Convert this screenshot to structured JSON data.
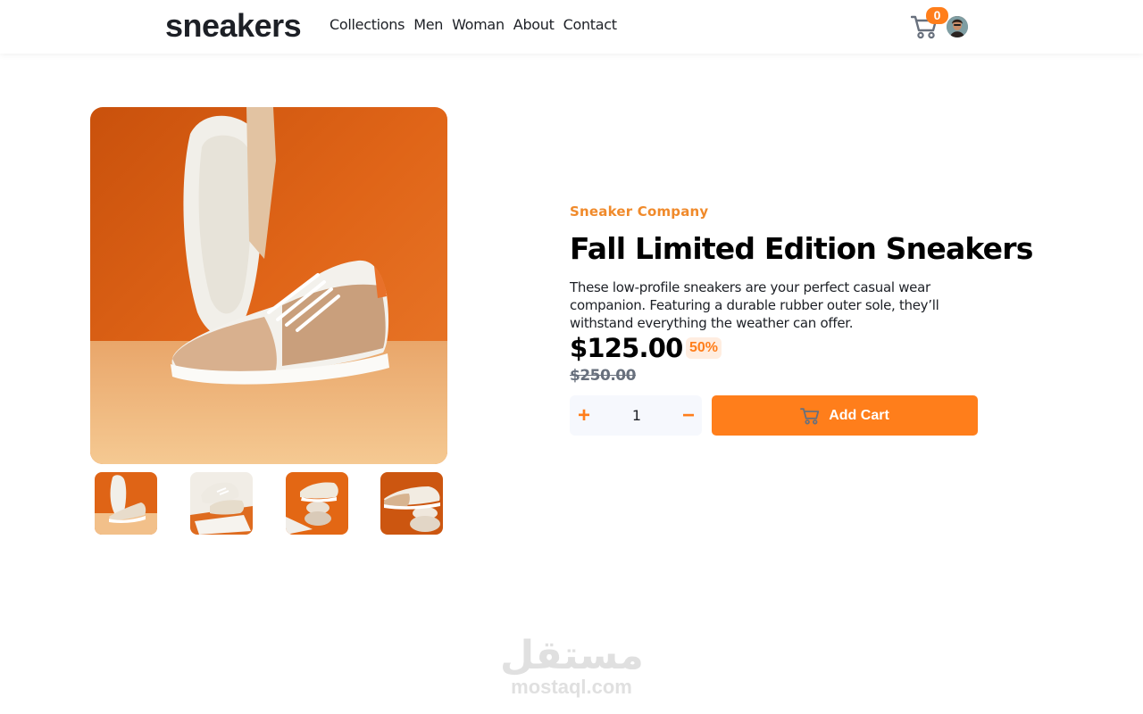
{
  "header": {
    "logo": "sneakers",
    "nav": [
      "Collections",
      "Men",
      "Woman",
      "About",
      "Contact"
    ],
    "cart_count": "0",
    "cart_icon": "cart-icon",
    "avatar": "user-avatar"
  },
  "gallery": {
    "main_image": "sneaker-sole-view",
    "thumbnails": [
      "sneaker-sole-view",
      "sneaker-on-fabric",
      "sneaker-on-stones",
      "sneaker-balanced-stones"
    ],
    "colors": {
      "orange_background": "#e46a14",
      "sand_floor": "#f0bd80"
    }
  },
  "product": {
    "company": "Sneaker Company",
    "title": "Fall Limited Edition Sneakers",
    "description": "These low-profile sneakers are your perfect casual wear companion. Featuring a durable rubber outer sole, they’ll withstand everything the weather can offer.",
    "price": "$125.00",
    "discount": "50%",
    "original_price": "$250.00",
    "quantity": "1",
    "plus_symbol": "+",
    "minus_symbol": "−",
    "add_to_cart_label": "Add Cart"
  },
  "watermark": {
    "arabic": "مستقل",
    "latin": "mostaql.com"
  },
  "colors": {
    "accent": "#ff7e1b",
    "accent_pale": "#ffede0",
    "text_dark": "#1d2026",
    "text_grey": "#68707d"
  }
}
